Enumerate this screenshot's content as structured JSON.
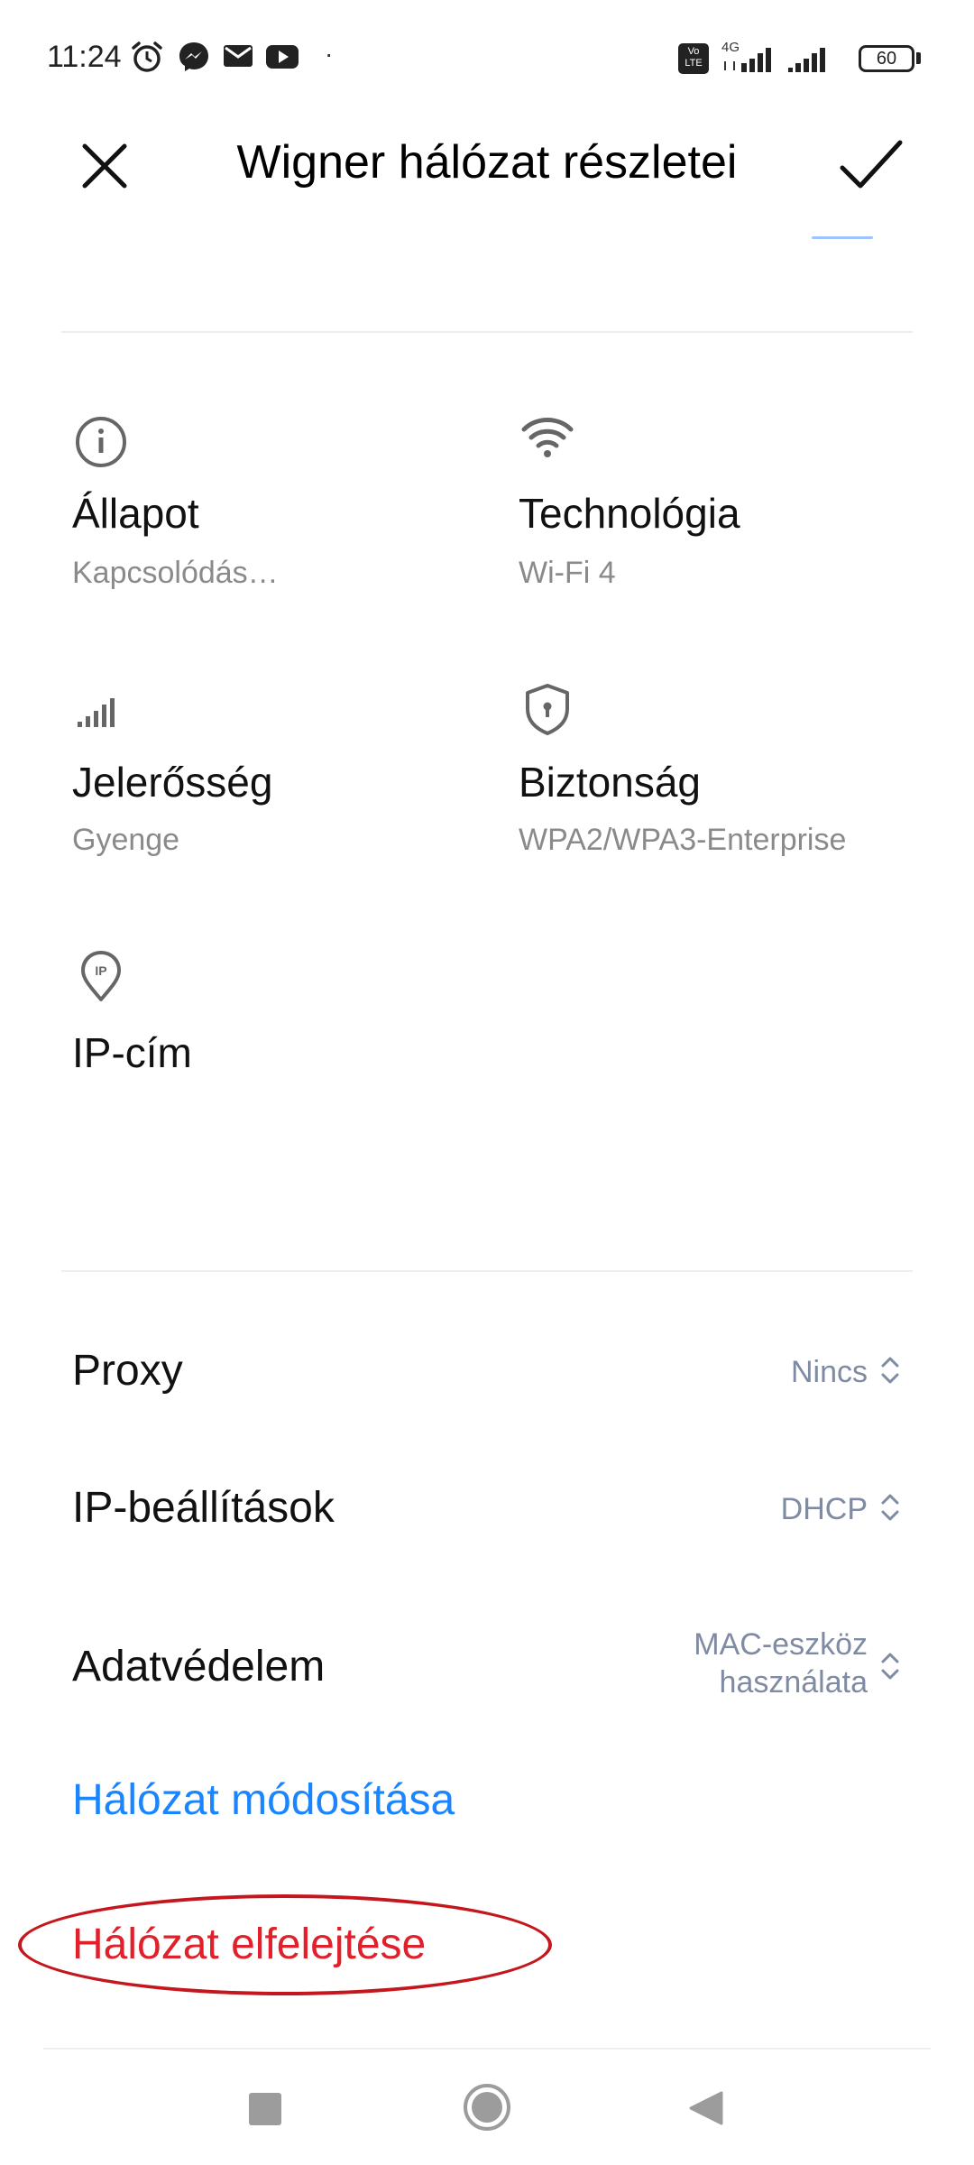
{
  "status_bar": {
    "time": "11:24",
    "dot": "·",
    "network": "4G",
    "volte": "Vo LTE",
    "battery": "60"
  },
  "header": {
    "title": "Wigner hálózat részletei",
    "close_icon": "close-icon",
    "confirm_icon": "check-icon"
  },
  "details": [
    {
      "icon": "info-icon",
      "label": "Állapot",
      "value": "Kapcsolódás…"
    },
    {
      "icon": "wifi-icon",
      "label": "Technológia",
      "value": "Wi-Fi 4"
    },
    {
      "icon": "signal-icon",
      "label": "Jelerősség",
      "value": "Gyenge"
    },
    {
      "icon": "shield-icon",
      "label": "Biztonság",
      "value": "WPA2/WPA3-Enterprise"
    },
    {
      "icon": "ip-location-icon",
      "label": "IP-cím",
      "value": ""
    }
  ],
  "settings": [
    {
      "label": "Proxy",
      "value": "Nincs"
    },
    {
      "label": "IP-beállítások",
      "value": "DHCP"
    },
    {
      "label": "Adatvédelem",
      "value_line1": "MAC-eszköz",
      "value_line2": "használata"
    }
  ],
  "actions": {
    "modify": "Hálózat módosítása",
    "forget": "Hálózat elfelejtése"
  },
  "colors": {
    "accent_blue": "#1a85ff",
    "danger_red": "#e0202a",
    "annotation_red": "#c4161c",
    "secondary_text": "#8a8a8a",
    "value_text": "#7f8aa3"
  }
}
